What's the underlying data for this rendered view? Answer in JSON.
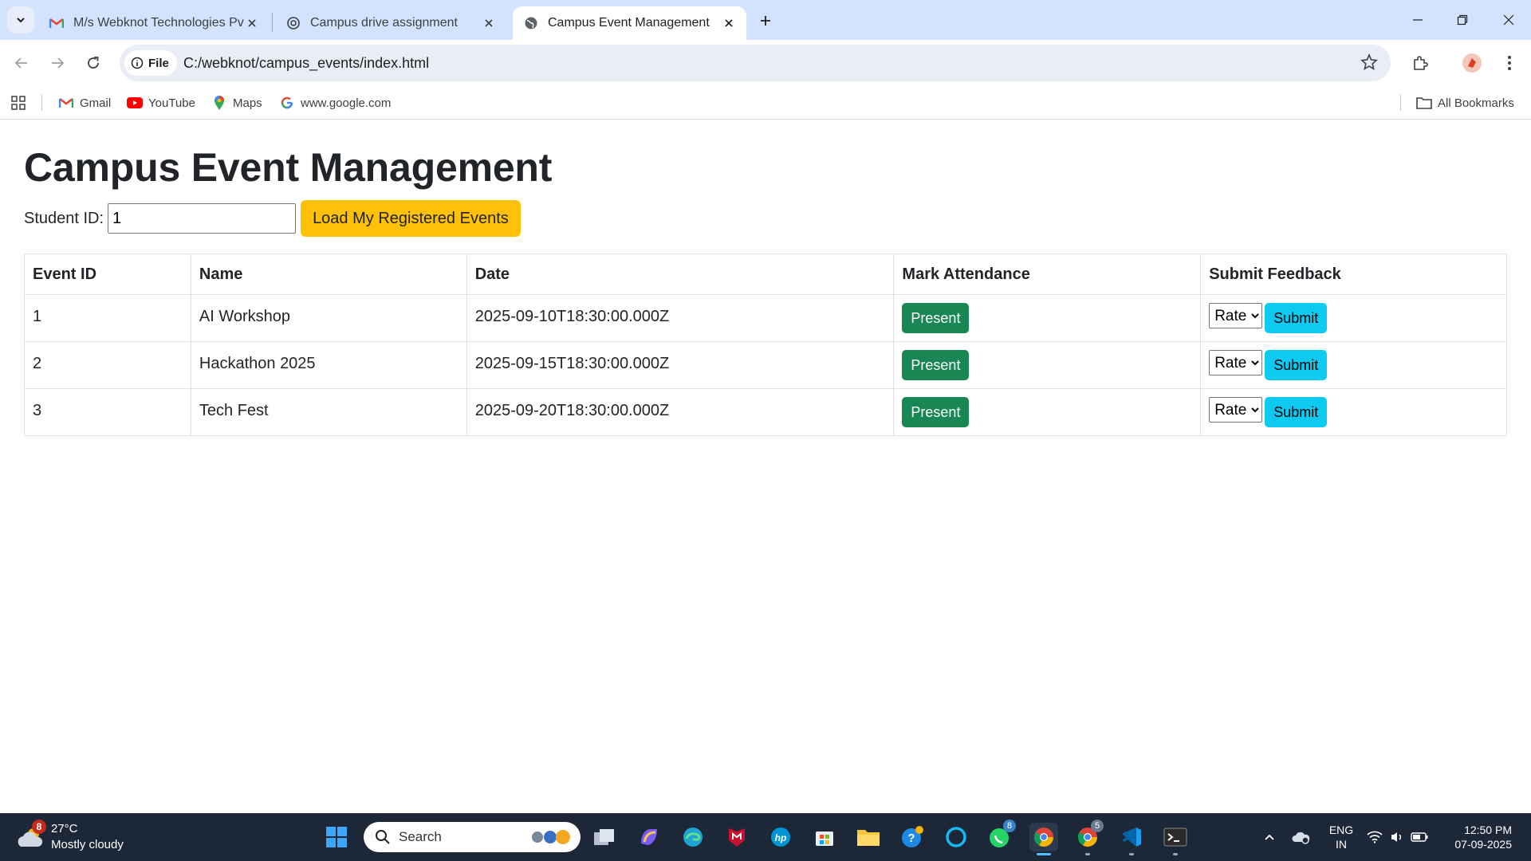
{
  "browser": {
    "tabs": [
      {
        "title": "M/s Webknot Technologies Pvt",
        "icon": "gmail-icon"
      },
      {
        "title": "Campus drive assignment",
        "icon": "chatgpt-icon"
      },
      {
        "title": "Campus Event Management",
        "icon": "globe-icon",
        "active": true
      }
    ],
    "address": {
      "chip_label": "File",
      "url": "C:/webknot/campus_events/index.html"
    },
    "bookmarks": [
      {
        "label": "Gmail",
        "icon": "gmail-icon"
      },
      {
        "label": "YouTube",
        "icon": "youtube-icon"
      },
      {
        "label": "Maps",
        "icon": "maps-icon"
      },
      {
        "label": "www.google.com",
        "icon": "google-icon"
      }
    ],
    "all_bookmarks_label": "All Bookmarks"
  },
  "page": {
    "title": "Campus Event Management",
    "student_id_label": "Student ID:",
    "student_id_value": "1",
    "load_button": "Load My Registered Events",
    "table": {
      "headers": [
        "Event ID",
        "Name",
        "Date",
        "Mark Attendance",
        "Submit Feedback"
      ],
      "rows": [
        {
          "id": "1",
          "name": "AI Workshop",
          "date": "2025-09-10T18:30:00.000Z",
          "attendance_label": "Present",
          "rate_label": "Rate",
          "submit_label": "Submit"
        },
        {
          "id": "2",
          "name": "Hackathon 2025",
          "date": "2025-09-15T18:30:00.000Z",
          "attendance_label": "Present",
          "rate_label": "Rate",
          "submit_label": "Submit"
        },
        {
          "id": "3",
          "name": "Tech Fest",
          "date": "2025-09-20T18:30:00.000Z",
          "attendance_label": "Present",
          "rate_label": "Rate",
          "submit_label": "Submit"
        }
      ]
    }
  },
  "taskbar": {
    "weather": {
      "temp": "27°C",
      "condition": "Mostly cloudy",
      "badge": "8"
    },
    "search_label": "Search",
    "whatsapp_badge": "8",
    "chrome_badge": "5",
    "lang": {
      "line1": "ENG",
      "line2": "IN"
    },
    "clock": {
      "time": "12:50 PM",
      "date": "07-09-2025"
    }
  },
  "colors": {
    "accent_load": "#ffc107",
    "present": "#198754",
    "submit": "#0dcaf0",
    "tabbar": "#d3e3fd"
  }
}
